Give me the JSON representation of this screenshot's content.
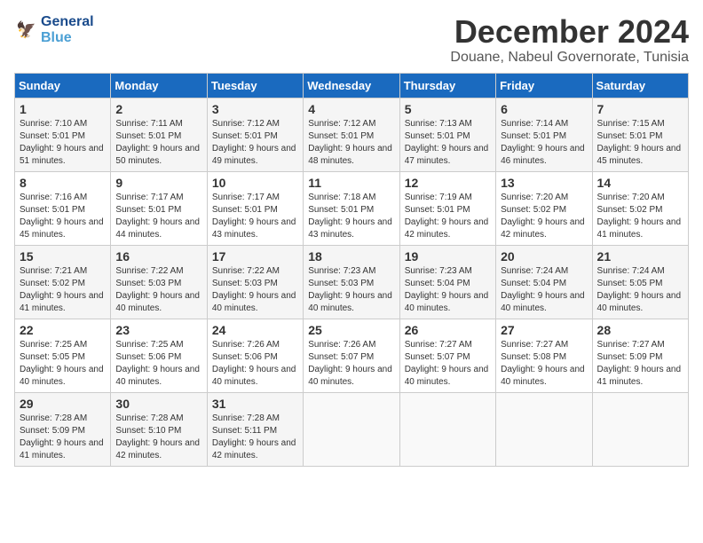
{
  "logo": {
    "general": "General",
    "blue": "Blue"
  },
  "title": "December 2024",
  "subtitle": "Douane, Nabeul Governorate, Tunisia",
  "weekdays": [
    "Sunday",
    "Monday",
    "Tuesday",
    "Wednesday",
    "Thursday",
    "Friday",
    "Saturday"
  ],
  "weeks": [
    [
      {
        "day": 1,
        "sunrise": "7:10 AM",
        "sunset": "5:01 PM",
        "daylight": "9 hours and 51 minutes."
      },
      {
        "day": 2,
        "sunrise": "7:11 AM",
        "sunset": "5:01 PM",
        "daylight": "9 hours and 50 minutes."
      },
      {
        "day": 3,
        "sunrise": "7:12 AM",
        "sunset": "5:01 PM",
        "daylight": "9 hours and 49 minutes."
      },
      {
        "day": 4,
        "sunrise": "7:12 AM",
        "sunset": "5:01 PM",
        "daylight": "9 hours and 48 minutes."
      },
      {
        "day": 5,
        "sunrise": "7:13 AM",
        "sunset": "5:01 PM",
        "daylight": "9 hours and 47 minutes."
      },
      {
        "day": 6,
        "sunrise": "7:14 AM",
        "sunset": "5:01 PM",
        "daylight": "9 hours and 46 minutes."
      },
      {
        "day": 7,
        "sunrise": "7:15 AM",
        "sunset": "5:01 PM",
        "daylight": "9 hours and 45 minutes."
      }
    ],
    [
      {
        "day": 8,
        "sunrise": "7:16 AM",
        "sunset": "5:01 PM",
        "daylight": "9 hours and 45 minutes."
      },
      {
        "day": 9,
        "sunrise": "7:17 AM",
        "sunset": "5:01 PM",
        "daylight": "9 hours and 44 minutes."
      },
      {
        "day": 10,
        "sunrise": "7:17 AM",
        "sunset": "5:01 PM",
        "daylight": "9 hours and 43 minutes."
      },
      {
        "day": 11,
        "sunrise": "7:18 AM",
        "sunset": "5:01 PM",
        "daylight": "9 hours and 43 minutes."
      },
      {
        "day": 12,
        "sunrise": "7:19 AM",
        "sunset": "5:01 PM",
        "daylight": "9 hours and 42 minutes."
      },
      {
        "day": 13,
        "sunrise": "7:20 AM",
        "sunset": "5:02 PM",
        "daylight": "9 hours and 42 minutes."
      },
      {
        "day": 14,
        "sunrise": "7:20 AM",
        "sunset": "5:02 PM",
        "daylight": "9 hours and 41 minutes."
      }
    ],
    [
      {
        "day": 15,
        "sunrise": "7:21 AM",
        "sunset": "5:02 PM",
        "daylight": "9 hours and 41 minutes."
      },
      {
        "day": 16,
        "sunrise": "7:22 AM",
        "sunset": "5:03 PM",
        "daylight": "9 hours and 40 minutes."
      },
      {
        "day": 17,
        "sunrise": "7:22 AM",
        "sunset": "5:03 PM",
        "daylight": "9 hours and 40 minutes."
      },
      {
        "day": 18,
        "sunrise": "7:23 AM",
        "sunset": "5:03 PM",
        "daylight": "9 hours and 40 minutes."
      },
      {
        "day": 19,
        "sunrise": "7:23 AM",
        "sunset": "5:04 PM",
        "daylight": "9 hours and 40 minutes."
      },
      {
        "day": 20,
        "sunrise": "7:24 AM",
        "sunset": "5:04 PM",
        "daylight": "9 hours and 40 minutes."
      },
      {
        "day": 21,
        "sunrise": "7:24 AM",
        "sunset": "5:05 PM",
        "daylight": "9 hours and 40 minutes."
      }
    ],
    [
      {
        "day": 22,
        "sunrise": "7:25 AM",
        "sunset": "5:05 PM",
        "daylight": "9 hours and 40 minutes."
      },
      {
        "day": 23,
        "sunrise": "7:25 AM",
        "sunset": "5:06 PM",
        "daylight": "9 hours and 40 minutes."
      },
      {
        "day": 24,
        "sunrise": "7:26 AM",
        "sunset": "5:06 PM",
        "daylight": "9 hours and 40 minutes."
      },
      {
        "day": 25,
        "sunrise": "7:26 AM",
        "sunset": "5:07 PM",
        "daylight": "9 hours and 40 minutes."
      },
      {
        "day": 26,
        "sunrise": "7:27 AM",
        "sunset": "5:07 PM",
        "daylight": "9 hours and 40 minutes."
      },
      {
        "day": 27,
        "sunrise": "7:27 AM",
        "sunset": "5:08 PM",
        "daylight": "9 hours and 40 minutes."
      },
      {
        "day": 28,
        "sunrise": "7:27 AM",
        "sunset": "5:09 PM",
        "daylight": "9 hours and 41 minutes."
      }
    ],
    [
      {
        "day": 29,
        "sunrise": "7:28 AM",
        "sunset": "5:09 PM",
        "daylight": "9 hours and 41 minutes."
      },
      {
        "day": 30,
        "sunrise": "7:28 AM",
        "sunset": "5:10 PM",
        "daylight": "9 hours and 42 minutes."
      },
      {
        "day": 31,
        "sunrise": "7:28 AM",
        "sunset": "5:11 PM",
        "daylight": "9 hours and 42 minutes."
      },
      null,
      null,
      null,
      null
    ]
  ]
}
